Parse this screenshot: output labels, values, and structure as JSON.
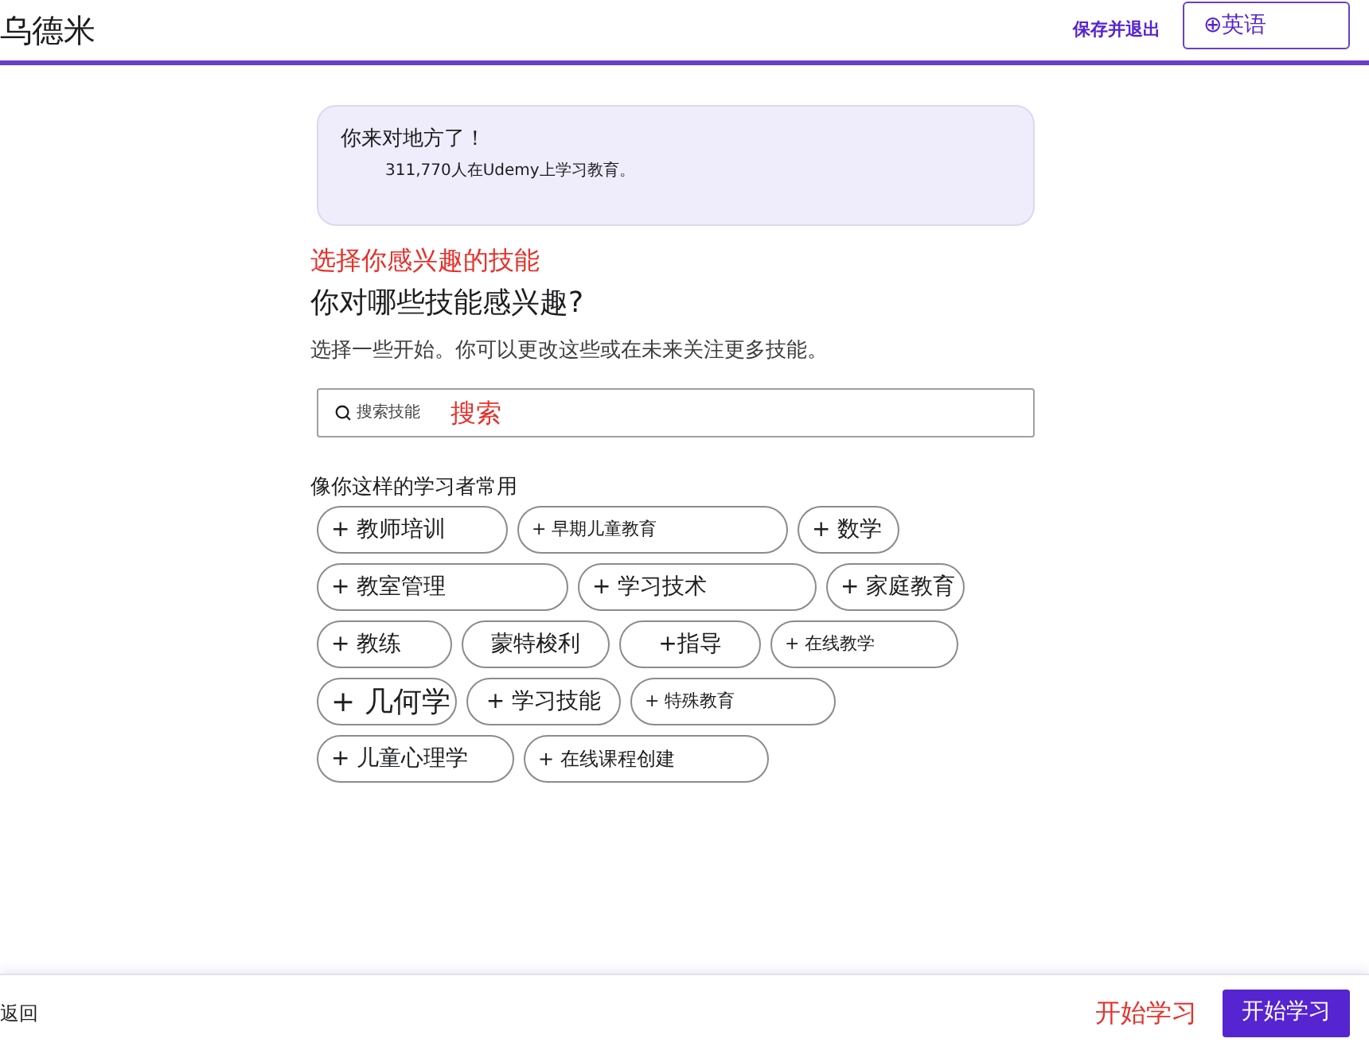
{
  "header": {
    "logo": "乌德米",
    "save_exit": "保存并退出",
    "language": "⊕英语"
  },
  "banner": {
    "title": "你来对地方了！",
    "subtitle": "311,770人在Udemy上学习教育。"
  },
  "annotation_heading": "选择你感兴趣的技能",
  "heading": "你对哪些技能感兴趣?",
  "description": "选择一些开始。你可以更改这些或在未来关注更多技能。",
  "search": {
    "placeholder": "搜索技能",
    "annotation": "搜索"
  },
  "popular": {
    "title": "像你这样的学习者常用",
    "skills": [
      {
        "label": "+ 教师培训",
        "selected": false
      },
      {
        "label": "+ 早期儿童教育",
        "selected": false
      },
      {
        "label": "+ 数学",
        "selected": false
      },
      {
        "label": "+ 教室管理",
        "selected": false
      },
      {
        "label": "+ 学习技术",
        "selected": false
      },
      {
        "label": "+ 家庭教育",
        "selected": false
      },
      {
        "label": "+ 教练",
        "selected": false
      },
      {
        "label": "蒙特梭利",
        "selected": false
      },
      {
        "label": "+指导",
        "selected": false
      },
      {
        "label": "+ 在线教学",
        "selected": false
      },
      {
        "label": "+ 几何学",
        "selected": false
      },
      {
        "label": "+ 学习技能",
        "selected": false
      },
      {
        "label": "+ 特殊教育",
        "selected": false
      },
      {
        "label": "+ 儿童心理学",
        "selected": false
      },
      {
        "label": "+ 在线课程创建",
        "selected": false
      }
    ]
  },
  "footer": {
    "back": "返回",
    "annotation": "开始学习",
    "start_button": "开始学习"
  }
}
